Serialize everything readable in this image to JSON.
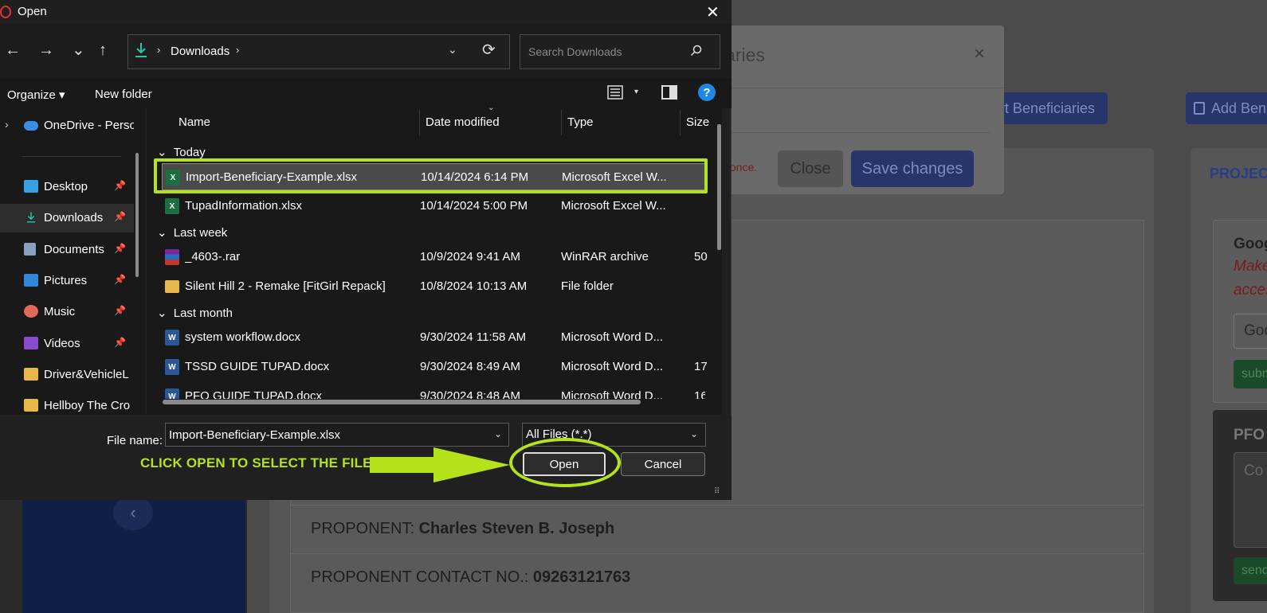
{
  "background_page": {
    "import_button": "rt Beneficiaries",
    "add_button": "Add Ben",
    "project_label": "PROJEC",
    "google_card": {
      "title": "Goog",
      "line1": "Make",
      "line2": "acces",
      "input_text": "Goo",
      "submit_label": "subm"
    },
    "pfo_card": {
      "title": "PFO",
      "textarea_text": "Co",
      "send_label": "send"
    },
    "rows": [
      {
        "label": "PROPONENT: ",
        "value": "Charles Steven B. Joseph"
      },
      {
        "label": "PROPONENT CONTACT NO.: ",
        "value": "09263121763"
      }
    ],
    "sidebar_arrow": "‹",
    "modal": {
      "title_fragment": "iaries",
      "close_x": "×",
      "note_fragment": "y once.",
      "close_button": "Close",
      "save_button": "Save changes"
    }
  },
  "dialog": {
    "title": "Open",
    "close_glyph": "✕",
    "nav": {
      "back": "←",
      "forward": "→",
      "recent": "⌄",
      "up": "↑"
    },
    "address": {
      "location": "Downloads",
      "chevron": "›",
      "dropdown": "⌄",
      "refresh": "⟳"
    },
    "search": {
      "placeholder": "Search Downloads"
    },
    "toolbar": {
      "organize": "Organize ▾",
      "new_folder": "New folder",
      "view_dropdown": "▾",
      "help": "?"
    },
    "nav_pane": [
      {
        "label": "OneDrive - Perso",
        "icon": "cloud-icon",
        "pinned": false,
        "expand": "›"
      },
      {
        "label": "Desktop",
        "icon": "desktop-icon",
        "pinned": true
      },
      {
        "label": "Downloads",
        "icon": "download-icon",
        "pinned": true,
        "active": true
      },
      {
        "label": "Documents",
        "icon": "document-icon",
        "pinned": true
      },
      {
        "label": "Pictures",
        "icon": "pictures-icon",
        "pinned": true
      },
      {
        "label": "Music",
        "icon": "music-icon",
        "pinned": true
      },
      {
        "label": "Videos",
        "icon": "videos-icon",
        "pinned": true
      },
      {
        "label": "Driver&VehicleL",
        "icon": "folder-icon",
        "pinned": false
      },
      {
        "label": "Hellboy The Cro",
        "icon": "folder-icon",
        "pinned": false
      }
    ],
    "pin_glyph": "📌",
    "columns": {
      "name": "Name",
      "date_modified": "Date modified",
      "type": "Type",
      "size": "Size"
    },
    "groups": [
      {
        "label": "Today",
        "files": [
          {
            "name": "Import-Beneficiary-Example.xlsx",
            "date": "10/14/2024 6:14 PM",
            "type": "Microsoft Excel W...",
            "size": "",
            "icon": "excel",
            "selected": true
          },
          {
            "name": "TupadInformation.xlsx",
            "date": "10/14/2024 5:00 PM",
            "type": "Microsoft Excel W...",
            "size": "",
            "icon": "excel"
          }
        ]
      },
      {
        "label": "Last week",
        "files": [
          {
            "name": "_4603-.rar",
            "date": "10/9/2024 9:41 AM",
            "type": "WinRAR archive",
            "size": "50",
            "icon": "rar"
          },
          {
            "name": "Silent Hill 2 - Remake [FitGirl Repack]",
            "date": "10/8/2024 10:13 AM",
            "type": "File folder",
            "size": "",
            "icon": "folder"
          }
        ]
      },
      {
        "label": "Last month",
        "files": [
          {
            "name": "system workflow.docx",
            "date": "9/30/2024 11:58 AM",
            "type": "Microsoft Word D...",
            "size": "",
            "icon": "word"
          },
          {
            "name": "TSSD GUIDE TUPAD.docx",
            "date": "9/30/2024 8:49 AM",
            "type": "Microsoft Word D...",
            "size": "17",
            "icon": "word"
          },
          {
            "name": "PFO GUIDE TUPAD.docx",
            "date": "9/30/2024 8:48 AM",
            "type": "Microsoft Word D...",
            "size": "16",
            "icon": "word"
          }
        ]
      }
    ],
    "group_chevron": "⌄",
    "excel_glyph": "X",
    "word_glyph": "W",
    "file_name_label": "File name:",
    "file_name_value": "Import-Beneficiary-Example.xlsx",
    "file_type_value": "All Files (*.*)",
    "open_button": "Open",
    "cancel_button": "Cancel",
    "resize_glyph": "⠿"
  },
  "annotation": {
    "instruction": "CLICK OPEN TO SELECT THE FILE",
    "color": "#b6e21c"
  }
}
